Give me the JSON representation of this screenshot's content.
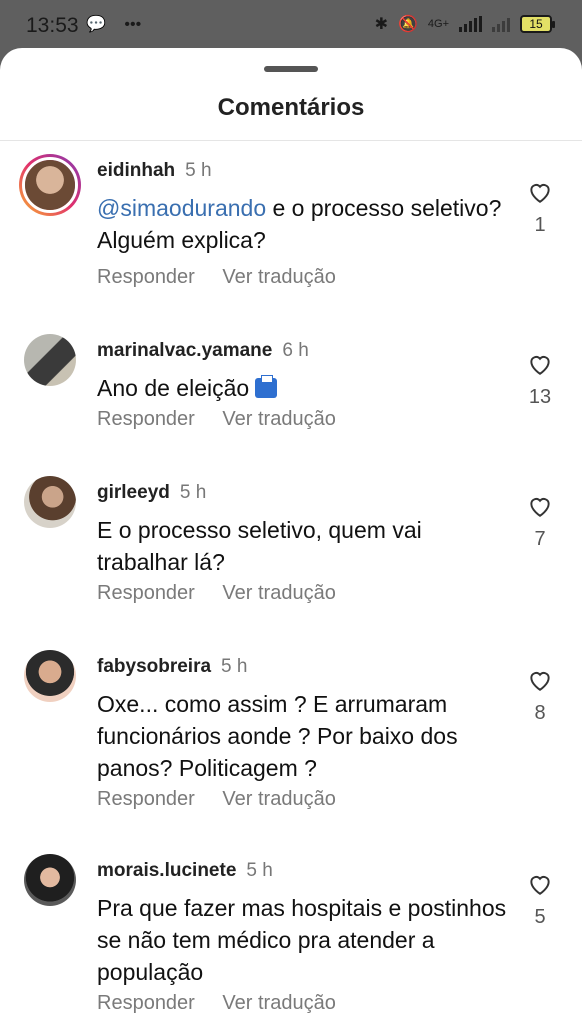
{
  "status_bar": {
    "time": "13:53",
    "network": "4G+",
    "battery": "15"
  },
  "sheet": {
    "title": "Comentários"
  },
  "action_labels": {
    "reply": "Responder",
    "translate": "Ver tradução"
  },
  "comments": [
    {
      "username": "eidinhah",
      "time": "5 h",
      "mention": "@simaodurando",
      "text": "e o processo seletivo? Alguém explica?",
      "likes": "1"
    },
    {
      "username": "marinalvac.yamane",
      "time": "6 h",
      "text": "Ano de eleição",
      "likes": "13"
    },
    {
      "username": "girleeyd",
      "time": "5 h",
      "text": "E o processo seletivo, quem vai trabalhar lá?",
      "likes": "7"
    },
    {
      "username": "fabysobreira",
      "time": "5 h",
      "text": "Oxe... como assim ? E arrumaram funcionários aonde ? Por baixo dos panos? Politicagem ?",
      "likes": "8"
    },
    {
      "username": "morais.lucinete",
      "time": "5 h",
      "text": "Pra que fazer mas hospitais e postinhos se não tem médico pra atender a população",
      "likes": "5"
    }
  ]
}
